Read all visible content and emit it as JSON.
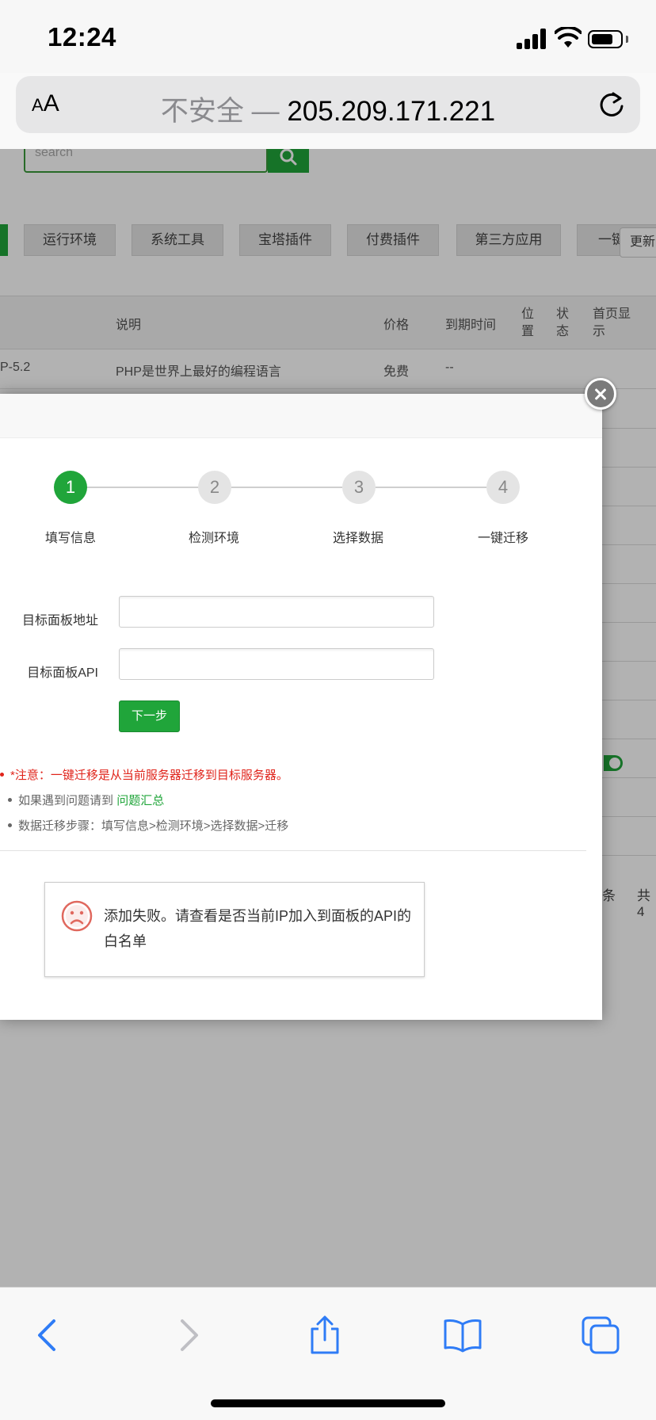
{
  "status_bar": {
    "time": "12:24"
  },
  "browser": {
    "text_size_label": "AA",
    "url_insecure_label": "不安全 —",
    "url_host": "205.209.171.221"
  },
  "page": {
    "search_placeholder": "search",
    "tabs": [
      "运行环境",
      "系统工具",
      "宝塔插件",
      "付费插件",
      "第三方应用",
      "一键"
    ],
    "update_button": "更新",
    "table": {
      "headers": [
        "说明",
        "价格",
        "到期时间",
        "位置",
        "状态",
        "首页显示"
      ],
      "first_row": {
        "name": "P-5.2",
        "desc": "PHP是世界上最好的编程语言",
        "price": "免费",
        "expiry": "--"
      }
    },
    "pagination": {
      "unit": "条",
      "total_prefix": "共4"
    }
  },
  "modal": {
    "steps": [
      {
        "num": "1",
        "label": "填写信息"
      },
      {
        "num": "2",
        "label": "检测环境"
      },
      {
        "num": "3",
        "label": "选择数据"
      },
      {
        "num": "4",
        "label": "一键迁移"
      }
    ],
    "fields": {
      "address_label": "目标面板地址",
      "address_value": "",
      "api_label": "目标面板API",
      "api_value": ""
    },
    "next_button": "下一步",
    "notes": {
      "warning": "*注意：一键迁移是从当前服务器迁移到目标服务器。",
      "help_text": "如果遇到问题请到",
      "help_link": "问题汇总",
      "steps_text": "数据迁移步骤：填写信息>检测环境>选择数据>迁移"
    },
    "alert_message": "添加失败。请查看是否当前IP加入到面板的API的白名单"
  },
  "colors": {
    "accent": "#20a53a",
    "warning": "#e0241b",
    "ios_blue": "#2f7cf6"
  },
  "icons": [
    "signal-icon",
    "wifi-icon",
    "battery-icon",
    "reload-icon",
    "search-icon",
    "close-icon",
    "sad-face-icon",
    "back-icon",
    "forward-icon",
    "share-icon",
    "bookmarks-icon",
    "tabs-icon"
  ]
}
